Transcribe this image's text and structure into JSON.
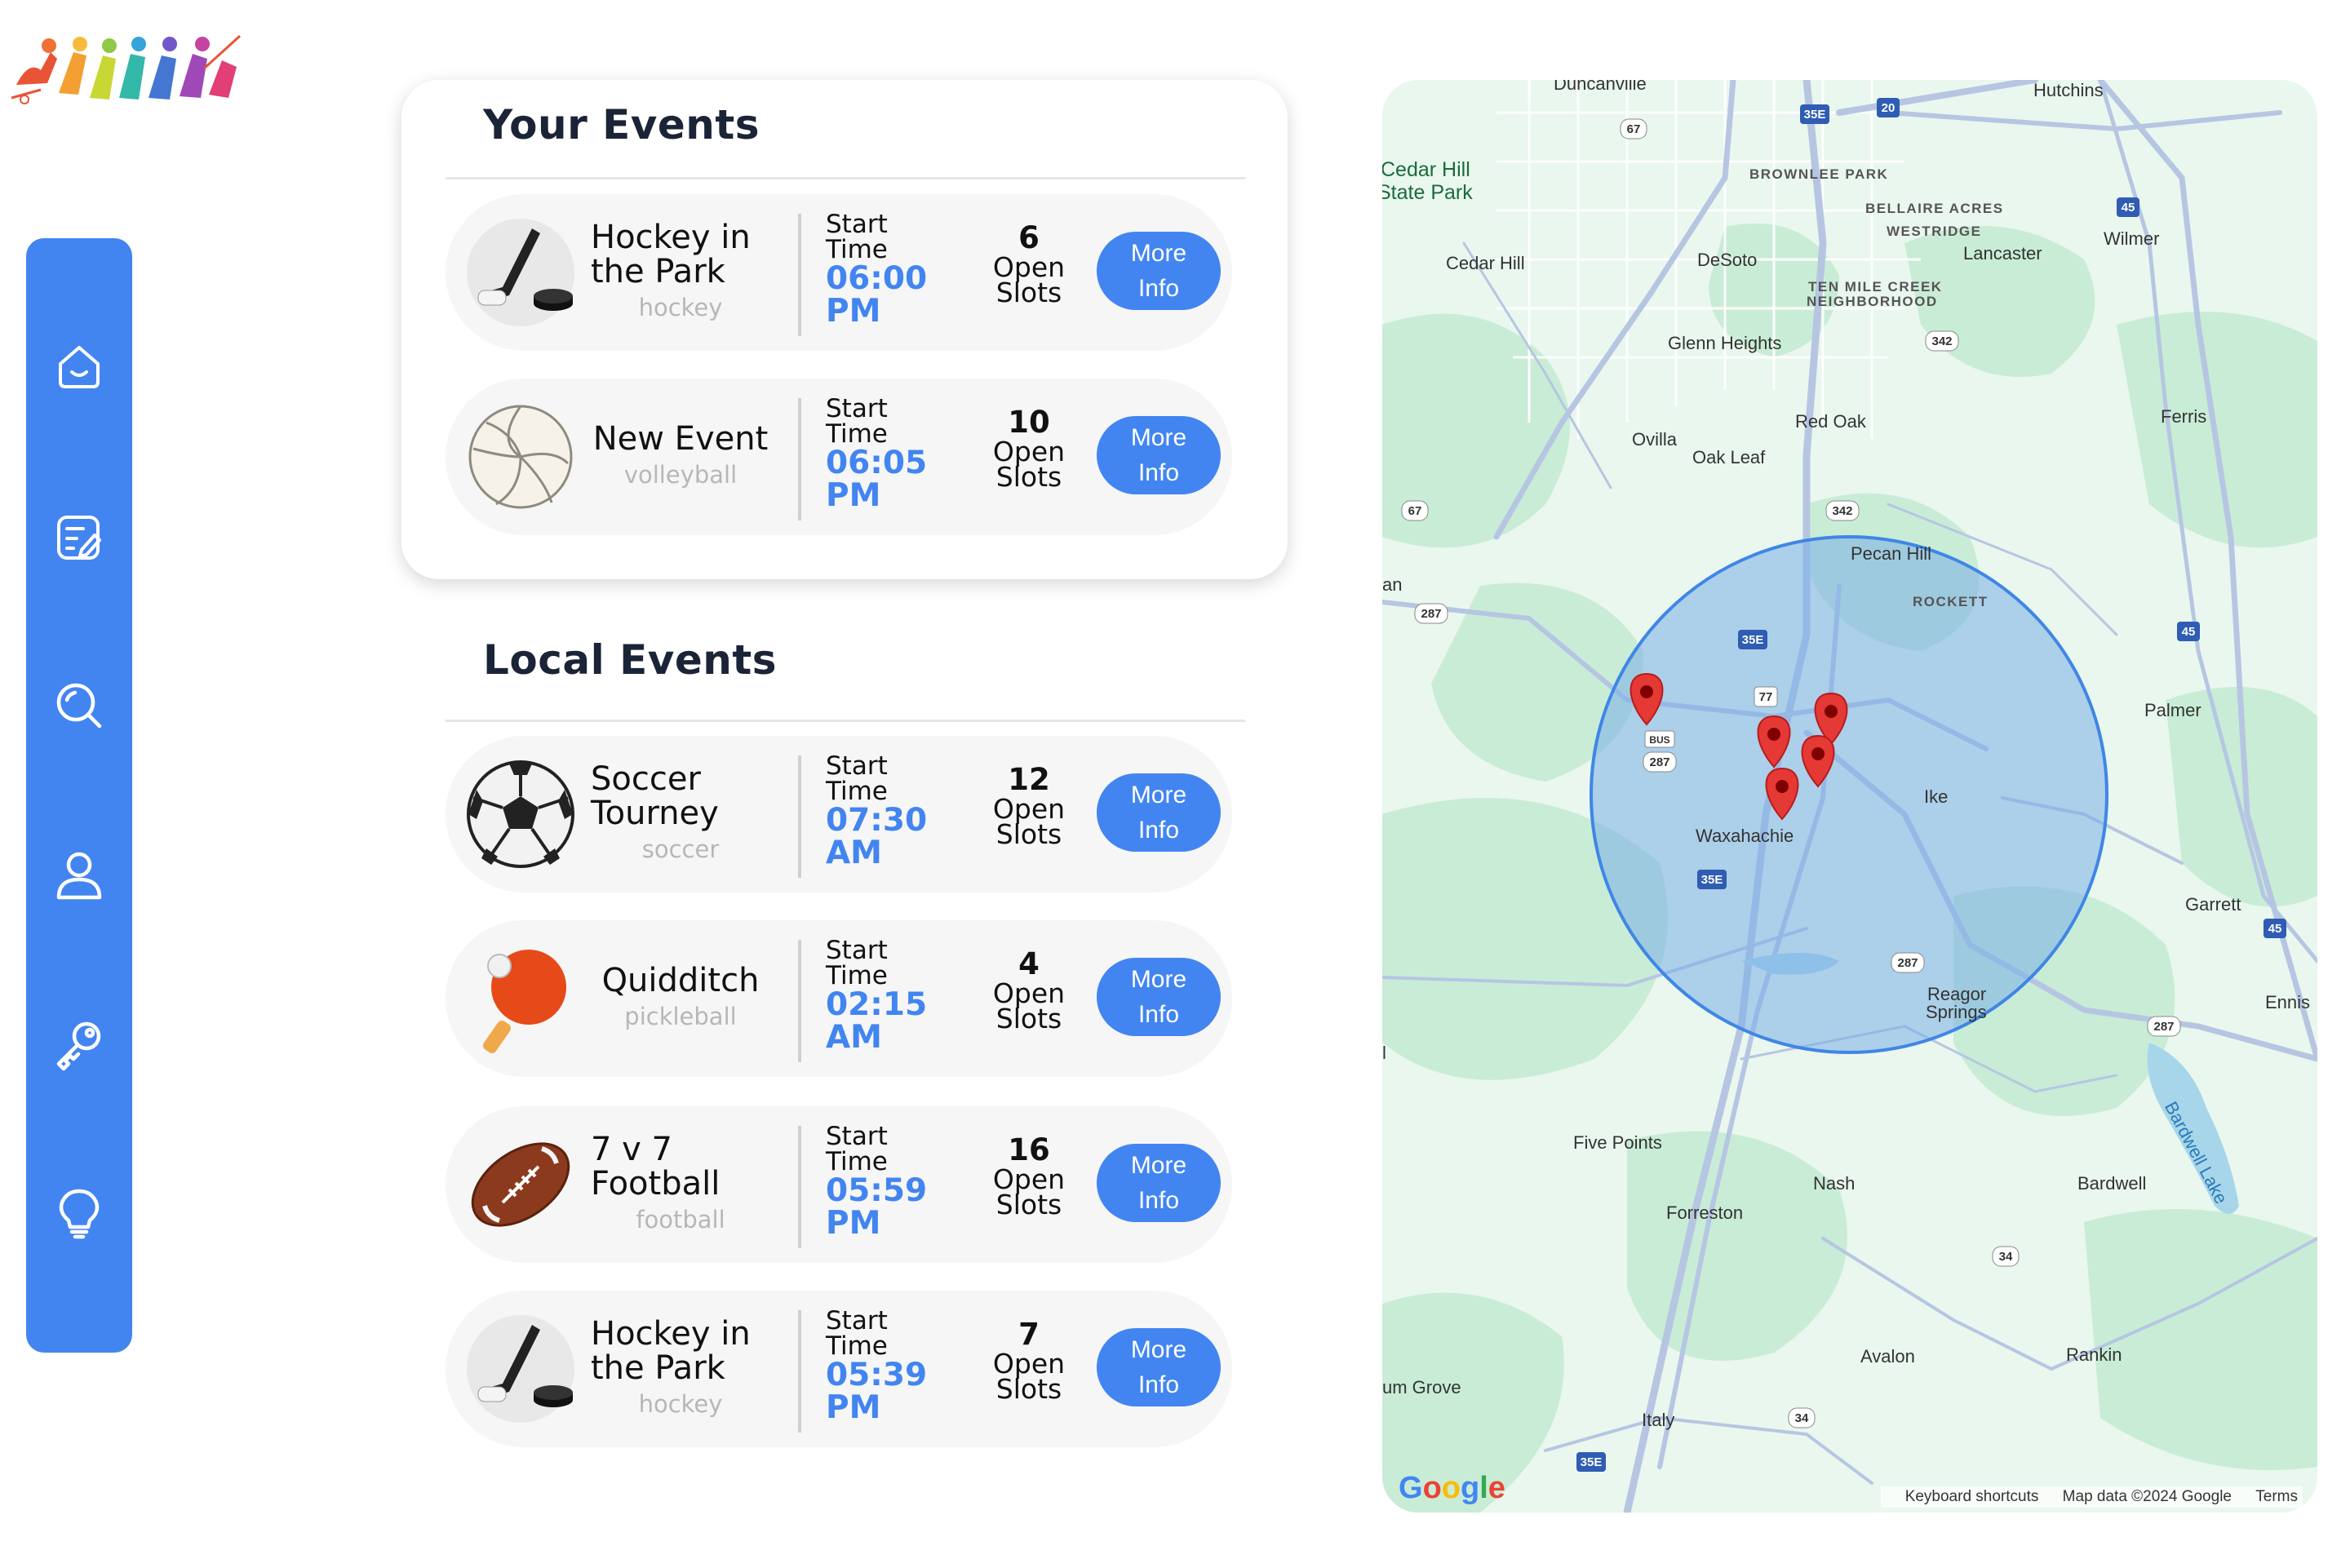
{
  "your_events": {
    "title": "Your Events",
    "items": [
      {
        "title_lines": [
          "Hockey in",
          "the Park"
        ],
        "sport": "hockey",
        "icon": "hockey-icon",
        "time_label_lines": [
          "Start",
          "Time"
        ],
        "time": "06:00",
        "ampm": "PM",
        "slots": "6",
        "slots_label_lines": [
          "Open",
          "Slots"
        ],
        "button_lines": [
          "More",
          "Info"
        ]
      },
      {
        "title_lines": [
          "New Event"
        ],
        "sport": "volleyball",
        "icon": "volleyball-icon",
        "time_label_lines": [
          "Start",
          "Time"
        ],
        "time": "06:05",
        "ampm": "PM",
        "slots": "10",
        "slots_label_lines": [
          "Open",
          "Slots"
        ],
        "button_lines": [
          "More",
          "Info"
        ]
      }
    ]
  },
  "local_events": {
    "title": "Local Events",
    "items": [
      {
        "title_lines": [
          "Soccer",
          "Tourney"
        ],
        "sport": "soccer",
        "icon": "soccer-ball-icon",
        "time_label_lines": [
          "Start",
          "Time"
        ],
        "time": "07:30",
        "ampm": "AM",
        "slots": "12",
        "slots_label_lines": [
          "Open",
          "Slots"
        ],
        "button_lines": [
          "More",
          "Info"
        ]
      },
      {
        "title_lines": [
          "Quidditch"
        ],
        "sport": "pickleball",
        "icon": "ping-pong-paddle-icon",
        "time_label_lines": [
          "Start",
          "Time"
        ],
        "time": "02:15",
        "ampm": "AM",
        "slots": "4",
        "slots_label_lines": [
          "Open",
          "Slots"
        ],
        "button_lines": [
          "More",
          "Info"
        ]
      },
      {
        "title_lines": [
          "7 v 7",
          "Football"
        ],
        "sport": "football",
        "icon": "football-icon",
        "time_label_lines": [
          "Start",
          "Time"
        ],
        "time": "05:59",
        "ampm": "PM",
        "slots": "16",
        "slots_label_lines": [
          "Open",
          "Slots"
        ],
        "button_lines": [
          "More",
          "Info"
        ]
      },
      {
        "title_lines": [
          "Hockey in",
          "the Park"
        ],
        "sport": "hockey",
        "icon": "hockey-icon",
        "time_label_lines": [
          "Start",
          "Time"
        ],
        "time": "05:39",
        "ampm": "PM",
        "slots": "7",
        "slots_label_lines": [
          "Open",
          "Slots"
        ],
        "button_lines": [
          "More",
          "Info"
        ]
      }
    ]
  },
  "sidebar": {
    "items": [
      {
        "name": "home-icon"
      },
      {
        "name": "edit-note-icon"
      },
      {
        "name": "search-icon"
      },
      {
        "name": "profile-icon"
      },
      {
        "name": "key-icon"
      },
      {
        "name": "lightbulb-icon"
      }
    ]
  },
  "map": {
    "places": [
      "Duncanville",
      "Hutchins",
      "Cedar Hill",
      "State Park",
      "Cedar Hill",
      "DeSoto",
      "Lancaster",
      "Wilmer",
      "Glenn Heights",
      "Red Oak",
      "Ferris",
      "Ovilla",
      "Oak Leaf",
      "Pecan Hill",
      "Palmer",
      "Waxahachie",
      "Ike",
      "Garrett",
      "Reagor",
      "Springs",
      "Ennis",
      "Five Points",
      "Nash",
      "Forreston",
      "Bardwell",
      "Avalon",
      "Rankin",
      "Italy",
      "um Grove",
      "an",
      "l"
    ],
    "caps_places": [
      "BROWNLEE PARK",
      "BELLAIRE ACRES",
      "WESTRIDGE",
      "TEN MILE CREEK",
      "NEIGHBORHOOD",
      "ROCKETT"
    ],
    "water": "Bardwell Lake",
    "shields": [
      "35E",
      "20",
      "67",
      "45",
      "342",
      "67",
      "342",
      "287",
      "35E",
      "77",
      "45",
      "BUS",
      "287",
      "35E",
      "287",
      "45",
      "287",
      "34",
      "34",
      "35E"
    ],
    "google_logo": "Google",
    "footer": [
      "Keyboard shortcuts",
      "Map data ©2024 Google",
      "Terms"
    ],
    "colors": {
      "land": "#e9f7ee",
      "green": "#c9ecd6",
      "road": "#b6c6e2",
      "circle_fill": "#7aaee8",
      "circle_stroke": "#3f86e6",
      "pin": "#e53935"
    }
  },
  "colors": {
    "accent": "#4285f0",
    "title": "#1b2437",
    "muted": "#b7b7b7"
  }
}
